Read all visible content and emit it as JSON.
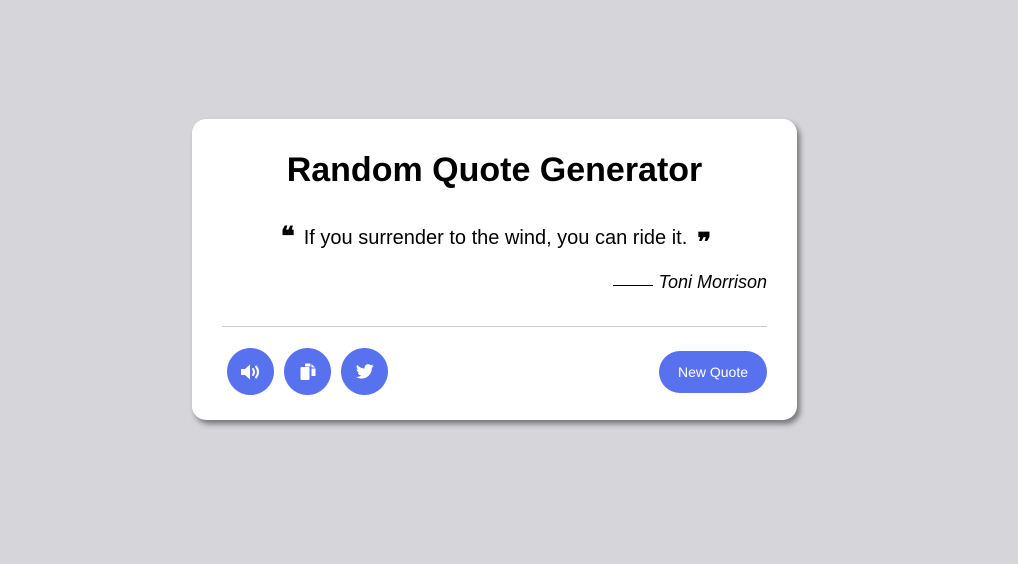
{
  "app": {
    "title": "Random Quote Generator"
  },
  "quote": {
    "open_mark": "❝",
    "text": "If you surrender to the wind, you can ride it.",
    "close_mark": "❞",
    "author": "Toni Morrison"
  },
  "actions": {
    "speak_icon": "volume-icon",
    "copy_icon": "copy-icon",
    "tweet_icon": "twitter-icon",
    "new_quote_label": "New Quote"
  },
  "colors": {
    "page_background": "#d6d6da",
    "card_background": "#ffffff",
    "accent": "#5872ef",
    "divider": "#cccccc"
  }
}
